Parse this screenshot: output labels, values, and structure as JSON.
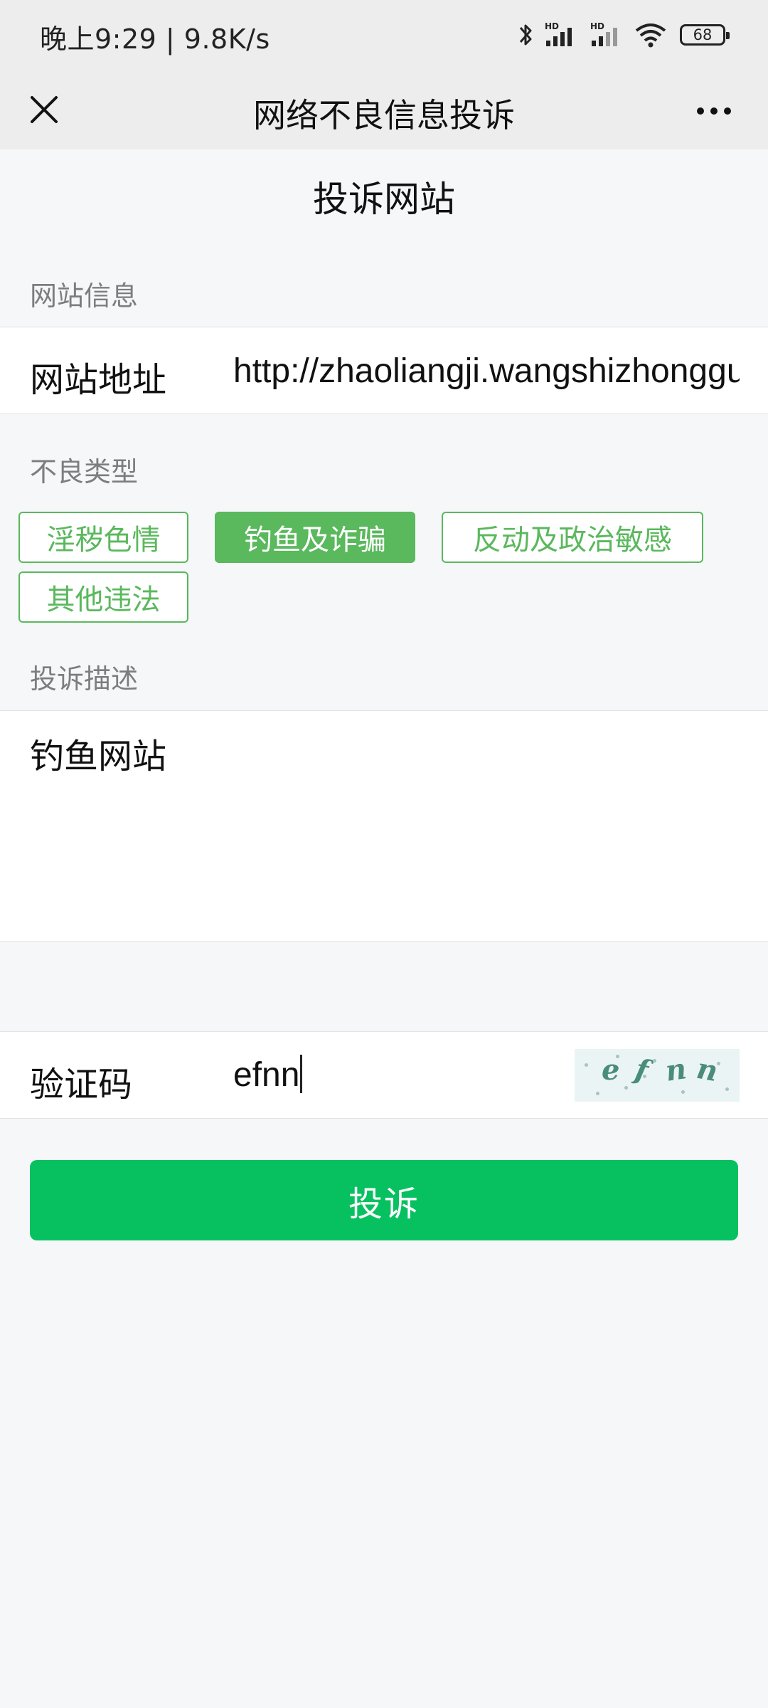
{
  "status_bar": {
    "time_text": "晚上9:29 | 9.8K/s",
    "battery": "68",
    "icons": [
      "bluetooth-icon",
      "signal-hd-icon",
      "signal-hd-icon",
      "wifi-icon",
      "battery-icon"
    ]
  },
  "nav": {
    "title": "网络不良信息投诉",
    "close_icon": "close-icon",
    "more_icon": "more-icon"
  },
  "page_heading": "投诉网站",
  "site_info": {
    "section_label": "网站信息",
    "url_label": "网站地址",
    "url_value": "http://zhaoliangji.wangshizhongguo.com"
  },
  "bad_type": {
    "section_label": "不良类型",
    "tags": [
      {
        "label": "淫秽色情",
        "selected": false
      },
      {
        "label": "钓鱼及诈骗",
        "selected": true
      },
      {
        "label": "反动及政治敏感",
        "selected": false
      },
      {
        "label": "其他违法",
        "selected": false
      }
    ]
  },
  "description": {
    "section_label": "投诉描述",
    "value": "钓鱼网站"
  },
  "captcha": {
    "label": "验证码",
    "input_value": "efnn",
    "image_text": "efnn"
  },
  "submit_label": "投诉",
  "colors": {
    "accent_green": "#07c160",
    "tag_green": "#5ab85d",
    "bar_bg": "#ededed",
    "page_bg": "#f6f7f9"
  }
}
